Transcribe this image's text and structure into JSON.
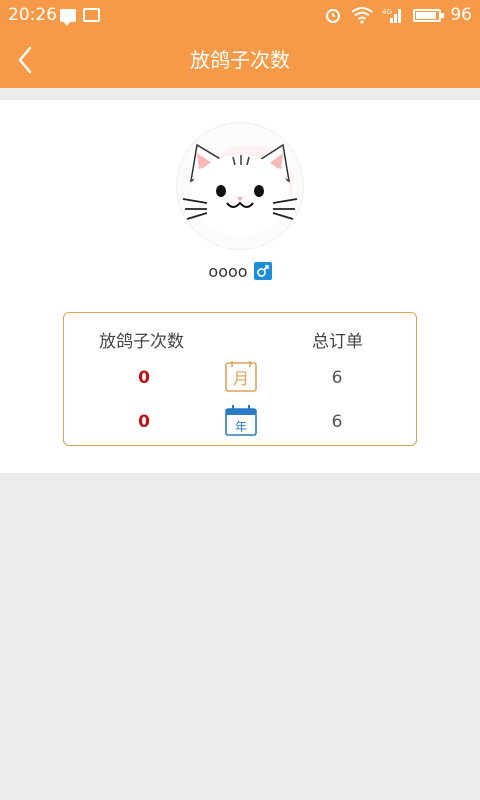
{
  "status_bar": {
    "time": "20:26",
    "battery": "96"
  },
  "header": {
    "title": "放鸽子次数"
  },
  "profile": {
    "username": "oooo",
    "gender_symbol": "♂"
  },
  "stats": {
    "left_header": "放鸽子次数",
    "right_header": "总订单",
    "month_label": "月",
    "year_label": "年",
    "rows": [
      {
        "period": "month",
        "left_value": "0",
        "right_value": "6"
      },
      {
        "period": "year",
        "left_value": "0",
        "right_value": "6"
      }
    ]
  },
  "colors": {
    "primary": "#f79a47",
    "accent_red": "#c0121a",
    "border": "#e0a25a",
    "gender_blue": "#1c8fd8"
  }
}
